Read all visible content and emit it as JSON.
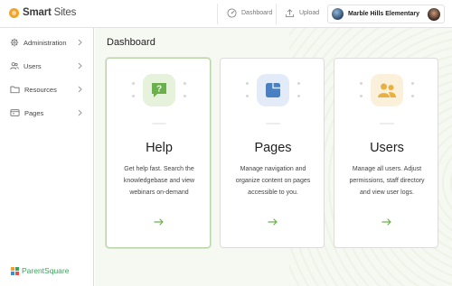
{
  "brand": {
    "name_bold": "Smart",
    "name_rest": " Sites",
    "color": "#f1a42c"
  },
  "topbar": {
    "dashboard_label": "Dashboard",
    "upload_label": "Upload",
    "school_name": "Marble Hills Elementary"
  },
  "sidebar": {
    "items": [
      {
        "label": "Administration",
        "icon": "gear-icon"
      },
      {
        "label": "Users",
        "icon": "users-icon"
      },
      {
        "label": "Resources",
        "icon": "folder-icon"
      },
      {
        "label": "Pages",
        "icon": "pages-icon"
      }
    ],
    "footer_logo": "ParentSquare"
  },
  "main": {
    "title": "Dashboard",
    "cards": [
      {
        "title": "Help",
        "description": "Get help fast. Search the knowledgebase and view webinars on-demand",
        "icon": "help-chat-icon",
        "accent": "#6ab04c",
        "arrow": "→"
      },
      {
        "title": "Pages",
        "description": "Manage navigation and organize content on pages accessible to you.",
        "icon": "pages-icon",
        "accent": "#4a7fc1",
        "arrow": "→"
      },
      {
        "title": "Users",
        "description": "Manage all users. Adjust permissions, staff directory and view user logs.",
        "icon": "users-icon",
        "accent": "#e8b040",
        "arrow": "→"
      }
    ]
  },
  "colors": {
    "accent_green": "#6ab04c",
    "sidebar_border": "#dcdcdc"
  }
}
